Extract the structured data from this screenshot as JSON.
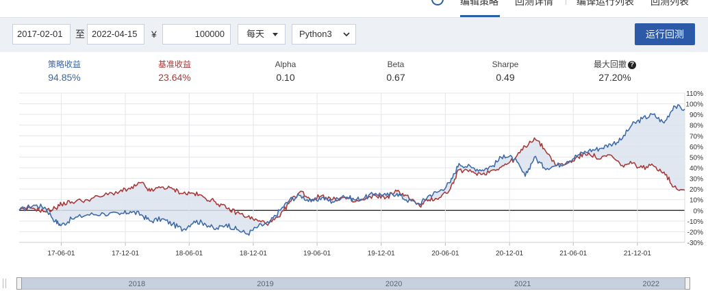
{
  "top_tabs": {
    "tab1": "编辑策略",
    "tab2": "回测详情",
    "tab3": "编译运行列表",
    "tab4": "回测列表"
  },
  "toolbar": {
    "start_date": "2017-02-01",
    "to_label": "至",
    "end_date": "2022-04-15",
    "currency_symbol": "¥",
    "capital": "100000",
    "frequency": "每天",
    "language": "Python3",
    "run_button": "运行回测"
  },
  "metrics": [
    {
      "label": "策略收益",
      "value": "94.85%",
      "label_color": "#3a65a9",
      "value_color": "#3a65a9"
    },
    {
      "label": "基准收益",
      "value": "23.64%",
      "label_color": "#a63a3a",
      "value_color": "#a63a3a"
    },
    {
      "label": "Alpha",
      "value": "0.10"
    },
    {
      "label": "Beta",
      "value": "0.67"
    },
    {
      "label": "Sharpe",
      "value": "0.49"
    },
    {
      "label": "最大回撤",
      "value": "27.20%"
    }
  ],
  "chart_data": {
    "type": "area",
    "y_ticks": [
      "110%",
      "100%",
      "90%",
      "80%",
      "70%",
      "60%",
      "50%",
      "40%",
      "30%",
      "20%",
      "10%",
      "0%",
      "-10%",
      "-20%",
      "-30%"
    ],
    "ylim": [
      -30,
      110
    ],
    "x_ticks": [
      "17-06-01",
      "17-12-01",
      "18-06-01",
      "18-12-01",
      "19-06-01",
      "19-12-01",
      "20-06-01",
      "20-12-01",
      "21-06-01",
      "21-12-01"
    ],
    "xlim": [
      "2017-02-01",
      "2022-04-15"
    ],
    "grid": true,
    "colors": {
      "strategy": "#3f6ba8",
      "benchmark": "#a83a3a",
      "fill": "#dbe3ee"
    },
    "series": [
      {
        "name": "策略收益",
        "x": [
          "2017-02-01",
          "2017-03-15",
          "2017-04-15",
          "2017-05-15",
          "2017-06-01",
          "2017-07-01",
          "2017-08-15",
          "2017-10-01",
          "2017-11-15",
          "2017-12-15",
          "2018-01-15",
          "2018-02-10",
          "2018-03-15",
          "2018-04-15",
          "2018-05-15",
          "2018-06-15",
          "2018-07-15",
          "2018-08-15",
          "2018-09-15",
          "2018-10-15",
          "2018-11-15",
          "2018-12-15",
          "2019-01-15",
          "2019-02-15",
          "2019-03-15",
          "2019-04-15",
          "2019-05-15",
          "2019-06-15",
          "2019-07-15",
          "2019-08-15",
          "2019-09-15",
          "2019-10-15",
          "2019-11-15",
          "2019-12-15",
          "2020-01-15",
          "2020-02-10",
          "2020-03-20",
          "2020-04-15",
          "2020-05-15",
          "2020-06-15",
          "2020-07-10",
          "2020-08-15",
          "2020-09-15",
          "2020-10-15",
          "2020-11-15",
          "2020-12-15",
          "2021-01-15",
          "2021-02-10",
          "2021-03-10",
          "2021-04-15",
          "2021-05-15",
          "2021-06-15",
          "2021-07-15",
          "2021-08-15",
          "2021-09-15",
          "2021-10-15",
          "2021-11-15",
          "2021-12-15",
          "2022-01-15",
          "2022-02-15",
          "2022-03-15",
          "2022-04-15"
        ],
        "y": [
          0,
          5,
          3,
          -10,
          -14,
          -8,
          -4,
          -3,
          -4,
          -1,
          -4,
          -10,
          -8,
          -13,
          -18,
          -10,
          -12,
          -18,
          -13,
          -18,
          -22,
          -15,
          -12,
          0,
          10,
          14,
          8,
          12,
          8,
          14,
          10,
          12,
          16,
          14,
          16,
          10,
          6,
          14,
          18,
          26,
          44,
          40,
          38,
          42,
          52,
          48,
          32,
          50,
          40,
          42,
          46,
          52,
          56,
          58,
          62,
          66,
          80,
          86,
          90,
          82,
          98,
          95
        ]
      },
      {
        "name": "基准收益",
        "x": [
          "2017-02-01",
          "2017-03-15",
          "2017-04-15",
          "2017-05-15",
          "2017-06-01",
          "2017-07-01",
          "2017-08-15",
          "2017-10-01",
          "2017-11-15",
          "2017-12-15",
          "2018-01-15",
          "2018-02-10",
          "2018-03-15",
          "2018-04-15",
          "2018-05-15",
          "2018-06-15",
          "2018-07-15",
          "2018-08-15",
          "2018-09-15",
          "2018-10-15",
          "2018-11-15",
          "2018-12-15",
          "2019-01-15",
          "2019-02-15",
          "2019-03-15",
          "2019-04-15",
          "2019-05-15",
          "2019-06-15",
          "2019-07-15",
          "2019-08-15",
          "2019-09-15",
          "2019-10-15",
          "2019-11-15",
          "2019-12-15",
          "2020-01-15",
          "2020-02-10",
          "2020-03-20",
          "2020-04-15",
          "2020-05-15",
          "2020-06-15",
          "2020-07-10",
          "2020-08-15",
          "2020-09-15",
          "2020-10-15",
          "2020-11-15",
          "2020-12-15",
          "2021-01-15",
          "2021-02-10",
          "2021-03-10",
          "2021-04-15",
          "2021-05-15",
          "2021-06-15",
          "2021-07-15",
          "2021-08-15",
          "2021-09-15",
          "2021-10-15",
          "2021-11-15",
          "2021-12-15",
          "2022-01-15",
          "2022-02-15",
          "2022-03-15",
          "2022-04-15"
        ],
        "y": [
          0,
          2,
          -1,
          2,
          6,
          8,
          10,
          14,
          18,
          20,
          26,
          18,
          22,
          20,
          16,
          16,
          12,
          8,
          2,
          -2,
          -6,
          -10,
          -12,
          -6,
          8,
          18,
          10,
          14,
          10,
          12,
          8,
          10,
          14,
          12,
          18,
          14,
          4,
          10,
          12,
          20,
          38,
          36,
          34,
          38,
          42,
          48,
          60,
          68,
          58,
          42,
          44,
          50,
          54,
          48,
          52,
          42,
          44,
          40,
          42,
          36,
          22,
          19
        ]
      }
    ]
  },
  "navigator": {
    "years": [
      "2018",
      "2019",
      "2020",
      "2021",
      "2022"
    ]
  }
}
